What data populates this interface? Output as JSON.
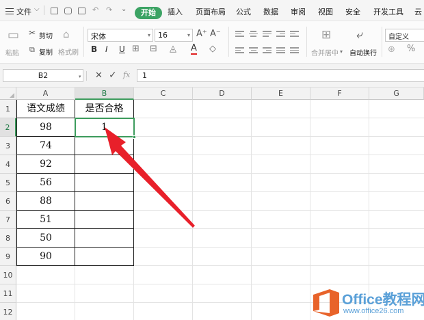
{
  "menu": {
    "file": "文件",
    "tabs": [
      "开始",
      "插入",
      "页面布局",
      "公式",
      "数据",
      "审阅",
      "视图",
      "安全",
      "开发工具",
      "云"
    ]
  },
  "ribbon": {
    "cut": "剪切",
    "copy": "复制",
    "paste": "粘贴",
    "format_painter": "格式刷",
    "font_name": "宋体",
    "font_size": "16",
    "grow_font": "A⁺",
    "shrink_font": "A⁻",
    "bold": "B",
    "italic": "I",
    "underline": "U",
    "font_color": "A",
    "merge_center": "合并居中",
    "wrap_text": "自动换行",
    "number_format": "自定义",
    "percent": "%"
  },
  "formula_bar": {
    "name_box": "B2",
    "cancel_icon": "✕",
    "confirm_icon": "✓",
    "fx": "fx",
    "content": "1"
  },
  "sheet": {
    "columns": [
      "A",
      "B",
      "C",
      "D",
      "E",
      "F",
      "G"
    ],
    "selected_column": "B",
    "rows": [
      "1",
      "2",
      "3",
      "4",
      "5",
      "6",
      "7",
      "8",
      "9",
      "10",
      "11",
      "12"
    ],
    "selected_row": "2",
    "header_a": "语文成绩",
    "header_b": "是否合格",
    "scores": [
      "98",
      "74",
      "92",
      "56",
      "88",
      "51",
      "50",
      "90"
    ],
    "b2_value": "1"
  },
  "annotation": {
    "arrow_color": "#e8202a"
  },
  "watermark": {
    "brand": "Office教程网",
    "url": "www.office26.com",
    "logo_color": "#e8632a"
  },
  "colors": {
    "accent": "#3ca364",
    "selection": "#3c9b5c"
  }
}
